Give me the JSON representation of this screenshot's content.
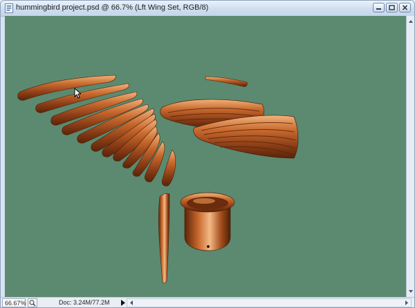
{
  "window": {
    "title": "hummingbird project.psd @ 66.7% (Lft Wing Set, RGB/8)",
    "icons": {
      "document": "document-icon",
      "minimize": "minimize-icon",
      "maximize": "maximize-icon",
      "close": "close-icon"
    }
  },
  "canvas": {
    "background": "#5b8a70",
    "feather_color": "#9a4a1c",
    "highlight_color": "#e8a06a"
  },
  "statusbar": {
    "zoom": "66.67%",
    "doc_info": "Doc: 3.24M/77.2M"
  }
}
